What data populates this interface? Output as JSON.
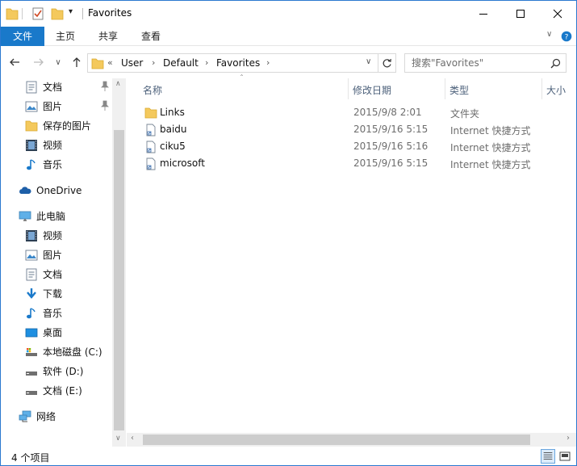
{
  "window": {
    "title": "Favorites"
  },
  "ribbon": {
    "tabs": [
      "文件",
      "主页",
      "共享",
      "查看"
    ]
  },
  "address": {
    "overflow": "«",
    "crumbs": [
      "User",
      "Default",
      "Favorites"
    ]
  },
  "search": {
    "placeholder": "搜索\"Favorites\""
  },
  "nav": {
    "quick_access": [
      "文档",
      "图片",
      "保存的图片",
      "视频",
      "音乐"
    ],
    "onedrive": "OneDrive",
    "this_pc": "此电脑",
    "pc_items": [
      "视频",
      "图片",
      "文档",
      "下载",
      "音乐",
      "桌面",
      "本地磁盘 (C:)",
      "软件 (D:)",
      "文档 (E:)"
    ],
    "network": "网络"
  },
  "columns": {
    "name": "名称",
    "modified": "修改日期",
    "type": "类型",
    "size": "大小"
  },
  "files": [
    {
      "name": "Links",
      "modified": "2015/9/8 2:01",
      "type": "文件夹"
    },
    {
      "name": "baidu",
      "modified": "2015/9/16 5:15",
      "type": "Internet 快捷方式"
    },
    {
      "name": "ciku5",
      "modified": "2015/9/16 5:16",
      "type": "Internet 快捷方式"
    },
    {
      "name": "microsoft",
      "modified": "2015/9/16 5:15",
      "type": "Internet 快捷方式"
    }
  ],
  "status": {
    "count": "4 个项目"
  },
  "colors": {
    "accent": "#1979ca",
    "folder": "#f4c95d",
    "border": "#2b79d0"
  }
}
